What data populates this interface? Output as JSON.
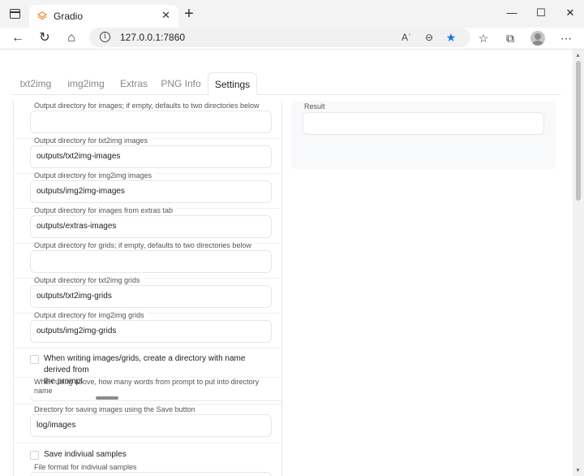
{
  "browser": {
    "tab_title": "Gradio",
    "tab_close": "✕",
    "new_tab": "+",
    "url": "127.0.0.1:7860",
    "window_controls": {
      "minimize": "—",
      "maximize": "☐",
      "close": "✕"
    },
    "nav_icons": {
      "back": "←",
      "refresh": "↻",
      "home": "⌂"
    },
    "address_icons": {
      "read_aloud": "Aʾ",
      "zoom": "⊖",
      "favorite": "★"
    },
    "toolbar_icons": {
      "favorites": "☆",
      "collections": "⧉",
      "more": "⋯"
    },
    "accent_color": "#1a73e8"
  },
  "gradio": {
    "tabs": [
      {
        "label": "txt2img"
      },
      {
        "label": "img2img"
      },
      {
        "label": "Extras"
      },
      {
        "label": "PNG Info"
      },
      {
        "label": "Settings"
      }
    ],
    "active_tab": "Settings",
    "settings": {
      "fields": [
        {
          "label": "Output directory for images; if empty, defaults to two directories below",
          "value": ""
        },
        {
          "label": "Output directory for txt2img images",
          "value": "outputs/txt2img-images"
        },
        {
          "label": "Output directory for img2img images",
          "value": "outputs/img2img-images"
        },
        {
          "label": "Output directory for images from extras tab",
          "value": "outputs/extras-images"
        },
        {
          "label": "Output directory for grids; if empty, defaults to two directories below",
          "value": ""
        },
        {
          "label": "Output directory for txt2img grids",
          "value": "outputs/txt2img-grids"
        },
        {
          "label": "Output directory for img2img grids",
          "value": "outputs/img2img-grids"
        }
      ],
      "create_dir_checkbox": {
        "label_line1": "When writing images/grids, create a directory with name derived from",
        "label_line2": "the prompt",
        "checked": false
      },
      "words_slider": {
        "label_line1": "When using above, how many words from prompt to put into directory",
        "label_line2": "name"
      },
      "save_dir_field": {
        "label": "Directory for saving images using the Save button",
        "value": "log/images"
      },
      "save_individual_checkbox": {
        "label": "Save indiviual samples",
        "checked": false
      },
      "file_format_label": "File format for indiviual samples"
    },
    "result": {
      "label": "Result",
      "value": ""
    }
  }
}
